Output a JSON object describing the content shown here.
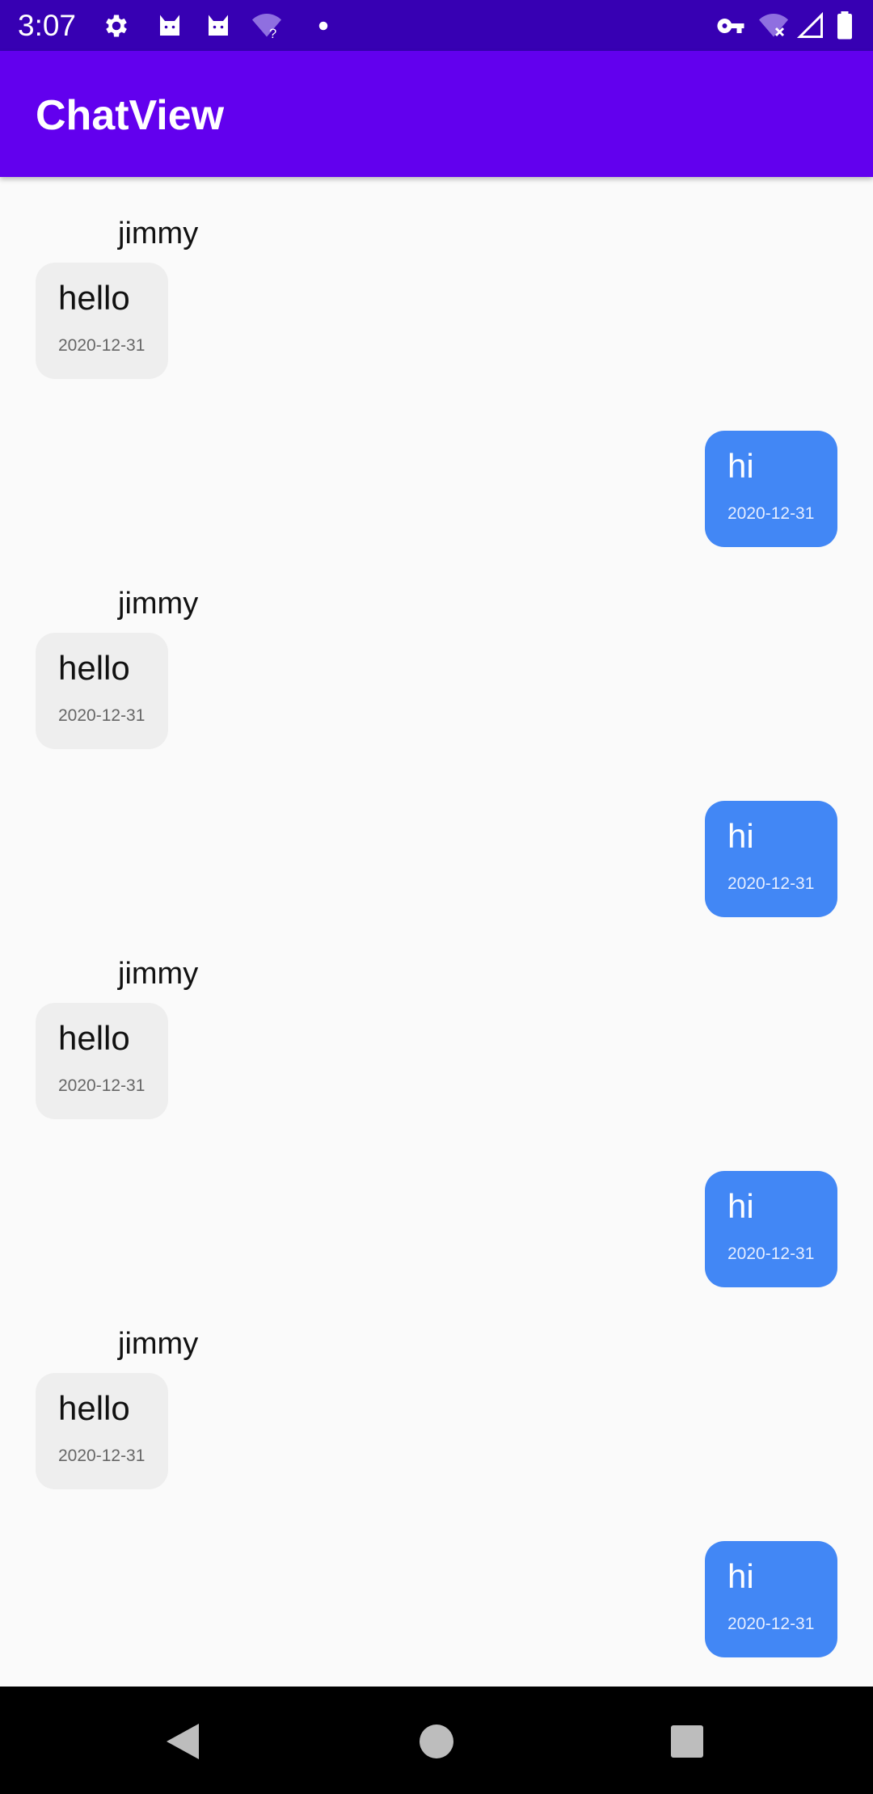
{
  "status_bar": {
    "time": "3:07",
    "left_icons": [
      "gear-icon",
      "cat-icon",
      "cat-icon",
      "wifi-question-icon",
      "dot-icon"
    ],
    "right_icons": [
      "vpn-key-icon",
      "wifi-off-icon",
      "signal-icon",
      "battery-icon"
    ],
    "wifi_question_mark": "?"
  },
  "app_bar": {
    "title": "ChatView",
    "color": "#6200EE"
  },
  "colors": {
    "status_bar": "#3700B3",
    "incoming_bubble": "#EEEEEE",
    "outgoing_bubble": "#4287F5",
    "background": "#FAFAFA"
  },
  "messages": [
    {
      "sender": "jimmy",
      "text": "hello",
      "date": "2020-12-31",
      "direction": "incoming"
    },
    {
      "text": "hi",
      "date": "2020-12-31",
      "direction": "outgoing"
    },
    {
      "sender": "jimmy",
      "text": "hello",
      "date": "2020-12-31",
      "direction": "incoming"
    },
    {
      "text": "hi",
      "date": "2020-12-31",
      "direction": "outgoing"
    },
    {
      "sender": "jimmy",
      "text": "hello",
      "date": "2020-12-31",
      "direction": "incoming"
    },
    {
      "text": "hi",
      "date": "2020-12-31",
      "direction": "outgoing"
    },
    {
      "sender": "jimmy",
      "text": "hello",
      "date": "2020-12-31",
      "direction": "incoming"
    },
    {
      "text": "hi",
      "date": "2020-12-31",
      "direction": "outgoing"
    }
  ],
  "nav_bar": {
    "buttons": [
      "back-icon",
      "home-icon",
      "recents-icon"
    ]
  }
}
